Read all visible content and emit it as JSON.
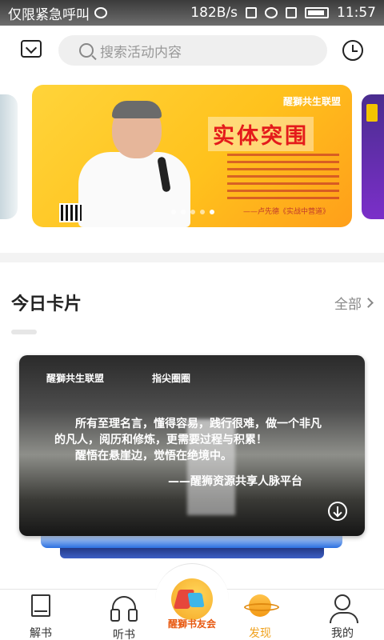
{
  "status_bar": {
    "left_text": "仅限紧急呼叫",
    "speed": "182B/s",
    "time": "11:57"
  },
  "top": {
    "search_placeholder": "搜索活动内容"
  },
  "banner": {
    "logo_text": "醒獅共生联盟",
    "headline": "实体突围",
    "author": "——卢先德《实战中营道》",
    "slide_count": 5,
    "active_index": 4
  },
  "today_cards": {
    "title": "今日卡片",
    "more_label": "全部",
    "card": {
      "logo_left": "醒獅共生联盟",
      "logo_right": "指尖圈圈",
      "quote_line1": "所有至理名言，懂得容易，践行很难，做一个非凡",
      "quote_line2": "的凡人，阅历和修炼，更需要过程与积累！",
      "quote_line3": "醒悟在悬崖边，觉悟在绝境中。",
      "signature": "——醒狮资源共享人脉平台"
    }
  },
  "bottom_nav": {
    "items": [
      {
        "label": "解书",
        "icon": "book-icon"
      },
      {
        "label": "听书",
        "icon": "headphones-icon"
      },
      {
        "label": "醒獅书友会",
        "icon": "club-emblem-icon"
      },
      {
        "label": "发现",
        "icon": "planet-icon",
        "active": true
      },
      {
        "label": "我的",
        "icon": "user-icon"
      }
    ]
  },
  "colors": {
    "accent": "#f0a21f",
    "banner_headline": "#e41b1b",
    "search_bg": "#efefef"
  }
}
